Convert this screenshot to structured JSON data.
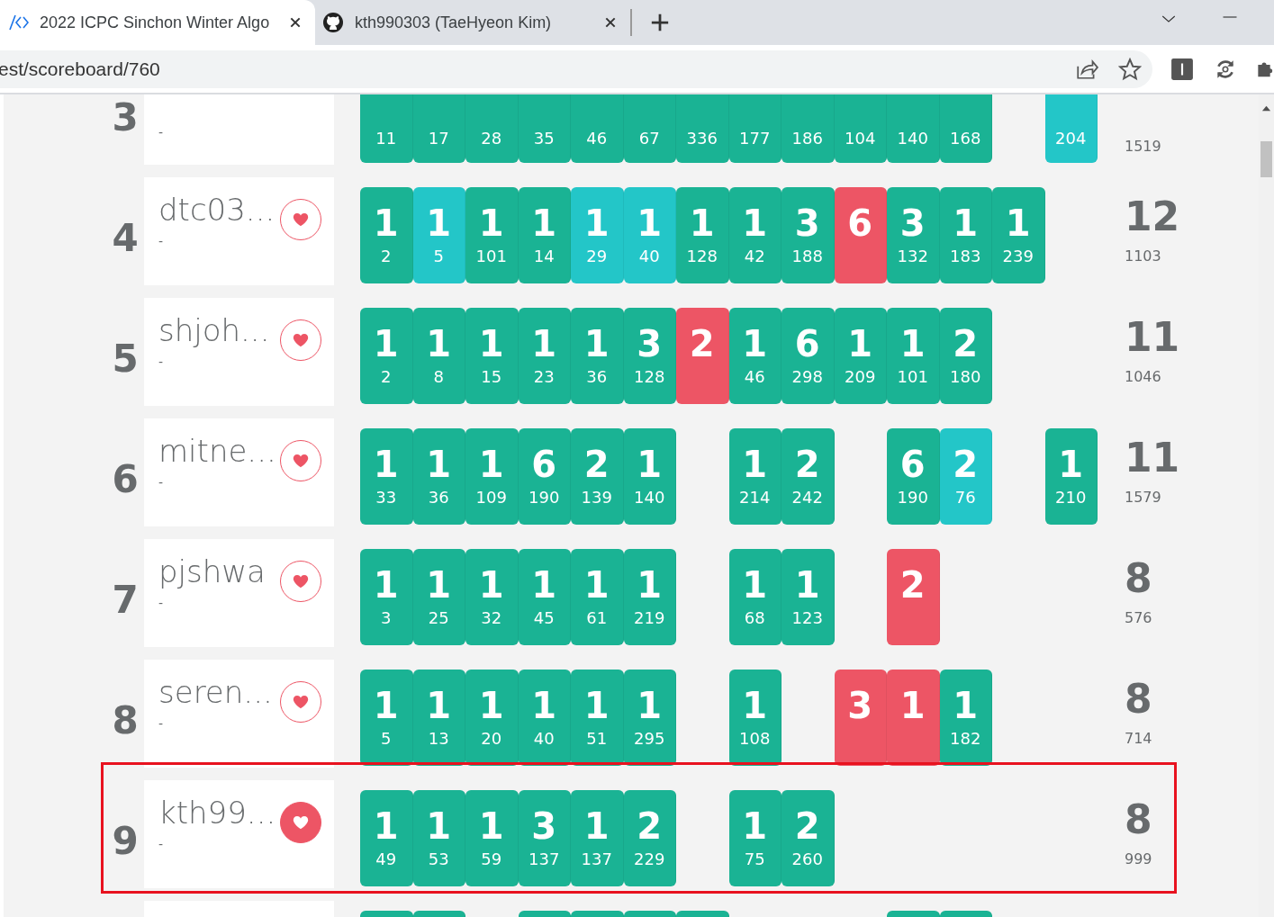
{
  "browser": {
    "tabs": [
      {
        "title": "2022 ICPC Sinchon Winter Algo",
        "selected": true,
        "kind": "code"
      },
      {
        "title": "kth990303 (TaeHyeon Kim)",
        "selected": false,
        "kind": "cat"
      }
    ],
    "address": "est/scoreboard/760"
  },
  "rows": [
    {
      "kind": "partial-top",
      "rank": "3",
      "note": "-",
      "penalty": "1519",
      "cells": [
        {
          "kind": "solved",
          "time": "11"
        },
        {
          "kind": "solved",
          "time": "17"
        },
        {
          "kind": "solved",
          "time": "28"
        },
        {
          "kind": "solved",
          "time": "35"
        },
        {
          "kind": "solved",
          "time": "46"
        },
        {
          "kind": "solved",
          "time": "67"
        },
        {
          "kind": "solved",
          "time": "336"
        },
        {
          "kind": "solved",
          "time": "177"
        },
        {
          "kind": "solved",
          "time": "186"
        },
        {
          "kind": "solved",
          "time": "104"
        },
        {
          "kind": "solved",
          "time": "140"
        },
        {
          "kind": "solved",
          "time": "168"
        },
        {
          "kind": "none"
        },
        {
          "kind": "first",
          "time": "204"
        }
      ]
    },
    {
      "kind": "full",
      "rank": "4",
      "name": "dtc03...",
      "note": "-",
      "favorite": false,
      "highlighted": false,
      "solved": "12",
      "penalty": "1103",
      "cells": [
        {
          "kind": "solved",
          "attempts": "1",
          "time": "2"
        },
        {
          "kind": "first",
          "attempts": "1",
          "time": "5"
        },
        {
          "kind": "solved",
          "attempts": "1",
          "time": "101"
        },
        {
          "kind": "solved",
          "attempts": "1",
          "time": "14"
        },
        {
          "kind": "first",
          "attempts": "1",
          "time": "29"
        },
        {
          "kind": "first",
          "attempts": "1",
          "time": "40"
        },
        {
          "kind": "solved",
          "attempts": "1",
          "time": "128"
        },
        {
          "kind": "solved",
          "attempts": "1",
          "time": "42"
        },
        {
          "kind": "solved",
          "attempts": "3",
          "time": "188"
        },
        {
          "kind": "failed",
          "attempts": "6"
        },
        {
          "kind": "solved",
          "attempts": "3",
          "time": "132"
        },
        {
          "kind": "solved",
          "attempts": "1",
          "time": "183"
        },
        {
          "kind": "solved",
          "attempts": "1",
          "time": "239"
        },
        {
          "kind": "none"
        }
      ]
    },
    {
      "kind": "full",
      "rank": "5",
      "name": "shjoh...",
      "note": "-",
      "favorite": false,
      "highlighted": false,
      "solved": "11",
      "penalty": "1046",
      "cells": [
        {
          "kind": "solved",
          "attempts": "1",
          "time": "2"
        },
        {
          "kind": "solved",
          "attempts": "1",
          "time": "8"
        },
        {
          "kind": "solved",
          "attempts": "1",
          "time": "15"
        },
        {
          "kind": "solved",
          "attempts": "1",
          "time": "23"
        },
        {
          "kind": "solved",
          "attempts": "1",
          "time": "36"
        },
        {
          "kind": "solved",
          "attempts": "3",
          "time": "128"
        },
        {
          "kind": "failed",
          "attempts": "2"
        },
        {
          "kind": "solved",
          "attempts": "1",
          "time": "46"
        },
        {
          "kind": "solved",
          "attempts": "6",
          "time": "298"
        },
        {
          "kind": "solved",
          "attempts": "1",
          "time": "209"
        },
        {
          "kind": "solved",
          "attempts": "1",
          "time": "101"
        },
        {
          "kind": "solved",
          "attempts": "2",
          "time": "180"
        },
        {
          "kind": "none"
        },
        {
          "kind": "none"
        }
      ]
    },
    {
      "kind": "full",
      "rank": "6",
      "name": "mitne...",
      "note": "-",
      "favorite": false,
      "highlighted": false,
      "solved": "11",
      "penalty": "1579",
      "cells": [
        {
          "kind": "solved",
          "attempts": "1",
          "time": "33"
        },
        {
          "kind": "solved",
          "attempts": "1",
          "time": "36"
        },
        {
          "kind": "solved",
          "attempts": "1",
          "time": "109"
        },
        {
          "kind": "solved",
          "attempts": "6",
          "time": "190"
        },
        {
          "kind": "solved",
          "attempts": "2",
          "time": "139"
        },
        {
          "kind": "solved",
          "attempts": "1",
          "time": "140"
        },
        {
          "kind": "none"
        },
        {
          "kind": "solved",
          "attempts": "1",
          "time": "214"
        },
        {
          "kind": "solved",
          "attempts": "2",
          "time": "242"
        },
        {
          "kind": "none"
        },
        {
          "kind": "solved",
          "attempts": "6",
          "time": "190"
        },
        {
          "kind": "first",
          "attempts": "2",
          "time": "76"
        },
        {
          "kind": "none"
        },
        {
          "kind": "solved",
          "attempts": "1",
          "time": "210"
        }
      ]
    },
    {
      "kind": "full",
      "rank": "7",
      "name": "pjshwa",
      "note": "-",
      "favorite": false,
      "highlighted": false,
      "solved": "8",
      "penalty": "576",
      "cells": [
        {
          "kind": "solved",
          "attempts": "1",
          "time": "3"
        },
        {
          "kind": "solved",
          "attempts": "1",
          "time": "25"
        },
        {
          "kind": "solved",
          "attempts": "1",
          "time": "32"
        },
        {
          "kind": "solved",
          "attempts": "1",
          "time": "45"
        },
        {
          "kind": "solved",
          "attempts": "1",
          "time": "61"
        },
        {
          "kind": "solved",
          "attempts": "1",
          "time": "219"
        },
        {
          "kind": "none"
        },
        {
          "kind": "solved",
          "attempts": "1",
          "time": "68"
        },
        {
          "kind": "solved",
          "attempts": "1",
          "time": "123"
        },
        {
          "kind": "none"
        },
        {
          "kind": "failed",
          "attempts": "2"
        },
        {
          "kind": "none"
        },
        {
          "kind": "none"
        },
        {
          "kind": "none"
        }
      ]
    },
    {
      "kind": "full",
      "rank": "8",
      "name": "seren...",
      "note": "-",
      "favorite": false,
      "highlighted": false,
      "solved": "8",
      "penalty": "714",
      "cells": [
        {
          "kind": "solved",
          "attempts": "1",
          "time": "5"
        },
        {
          "kind": "solved",
          "attempts": "1",
          "time": "13"
        },
        {
          "kind": "solved",
          "attempts": "1",
          "time": "20"
        },
        {
          "kind": "solved",
          "attempts": "1",
          "time": "40"
        },
        {
          "kind": "solved",
          "attempts": "1",
          "time": "51"
        },
        {
          "kind": "solved",
          "attempts": "1",
          "time": "295"
        },
        {
          "kind": "none"
        },
        {
          "kind": "solved",
          "attempts": "1",
          "time": "108"
        },
        {
          "kind": "none"
        },
        {
          "kind": "failed",
          "attempts": "3"
        },
        {
          "kind": "failed",
          "attempts": "1"
        },
        {
          "kind": "solved",
          "attempts": "1",
          "time": "182"
        },
        {
          "kind": "none"
        },
        {
          "kind": "none"
        }
      ]
    },
    {
      "kind": "full",
      "rank": "9",
      "name": "kth99...",
      "note": "-",
      "favorite": true,
      "highlighted": true,
      "solved": "8",
      "penalty": "999",
      "cells": [
        {
          "kind": "solved",
          "attempts": "1",
          "time": "49"
        },
        {
          "kind": "solved",
          "attempts": "1",
          "time": "53"
        },
        {
          "kind": "solved",
          "attempts": "1",
          "time": "59"
        },
        {
          "kind": "solved",
          "attempts": "3",
          "time": "137"
        },
        {
          "kind": "solved",
          "attempts": "1",
          "time": "137"
        },
        {
          "kind": "solved",
          "attempts": "2",
          "time": "229"
        },
        {
          "kind": "none"
        },
        {
          "kind": "solved",
          "attempts": "1",
          "time": "75"
        },
        {
          "kind": "solved",
          "attempts": "2",
          "time": "260"
        },
        {
          "kind": "none"
        },
        {
          "kind": "none"
        },
        {
          "kind": "none"
        },
        {
          "kind": "none"
        },
        {
          "kind": "none"
        }
      ]
    },
    {
      "kind": "partial-bottom",
      "cells": [
        {
          "kind": "solved"
        },
        {
          "kind": "solved"
        },
        {
          "kind": "none"
        },
        {
          "kind": "solved"
        },
        {
          "kind": "solved"
        },
        {
          "kind": "solved"
        },
        {
          "kind": "solved"
        },
        {
          "kind": "none"
        },
        {
          "kind": "none"
        },
        {
          "kind": "none"
        },
        {
          "kind": "solved"
        },
        {
          "kind": "solved"
        },
        {
          "kind": "none"
        },
        {
          "kind": "none"
        }
      ]
    }
  ]
}
